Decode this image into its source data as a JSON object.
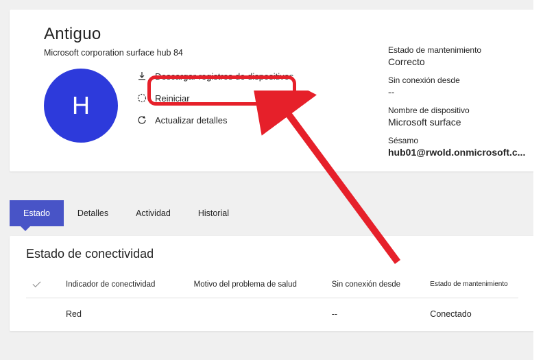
{
  "header": {
    "title": "Antiguo",
    "subtitle": "Microsoft corporation surface hub 84",
    "avatar_letter": "H"
  },
  "actions": {
    "download_logs": "Descargar registros de dispositivos",
    "restart": "Reiniciar",
    "refresh_details": "Actualizar detalles"
  },
  "maintenance": {
    "state_label": "Estado de mantenimiento",
    "state_value": "Correcto",
    "offline_since_label": "Sin conexión desde",
    "offline_since_value": "--",
    "device_name_label": "Nombre de dispositivo",
    "device_name_value": "Microsoft surface",
    "sesame_label": "Sésamo",
    "sesame_value": "hub01@rwold.onmicrosoft.c..."
  },
  "tabs": {
    "items": [
      {
        "label": "Estado",
        "active": true
      },
      {
        "label": "Detalles",
        "active": false
      },
      {
        "label": "Actividad",
        "active": false
      },
      {
        "label": "Historial",
        "active": false
      }
    ]
  },
  "connectivity": {
    "panel_title": "Estado de conectividad",
    "columns": [
      "Indicador de conectividad",
      "Motivo del problema de salud",
      "Sin conexión desde",
      "Estado de mantenimiento"
    ],
    "rows": [
      {
        "indicator": "Red",
        "reason": "",
        "offline": "--",
        "state": "Conectado"
      }
    ]
  },
  "annotation": {
    "highlight_target": "download-logs-action",
    "arrow_color": "#e6202a"
  }
}
